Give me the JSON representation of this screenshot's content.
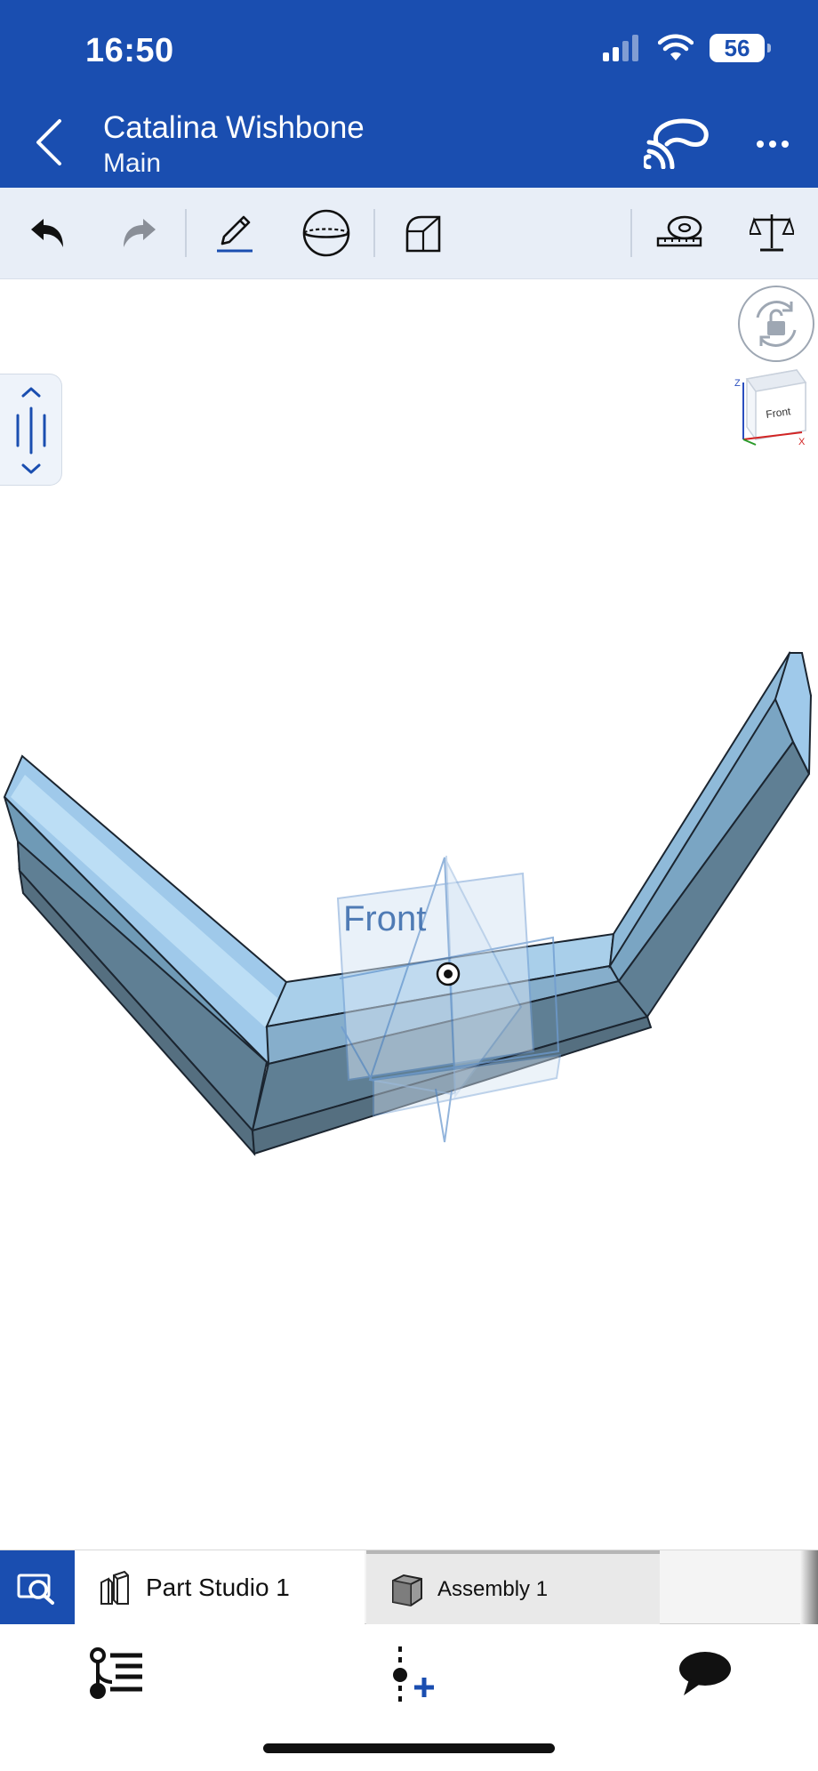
{
  "status_bar": {
    "time": "16:50",
    "battery": "56"
  },
  "header": {
    "title": "Catalina Wishbone",
    "subtitle": "Main"
  },
  "toolbar": {
    "items": [
      "undo-icon",
      "redo-icon",
      "sketch-pencil-icon",
      "plane-sphere-icon",
      "fillet-cube-icon",
      "measure-tape-icon",
      "mass-properties-scale-icon"
    ]
  },
  "viewport": {
    "view_cube_label": "Front",
    "plane_label": "Front",
    "axes": {
      "x": "X",
      "z": "Z"
    },
    "colors": {
      "part_light": "#9fc9ea",
      "part_dark": "#5f7f94",
      "plane": "#6e9bd0"
    }
  },
  "tabs": [
    {
      "label": "Part Studio 1",
      "active": true
    },
    {
      "label": "Assembly 1",
      "active": false
    }
  ],
  "bottom_nav": [
    "feature-list-icon",
    "insert-feature-icon",
    "comments-icon"
  ],
  "colors": {
    "brand": "#1a4eb0",
    "toolbar_bg": "#e8eef7"
  }
}
